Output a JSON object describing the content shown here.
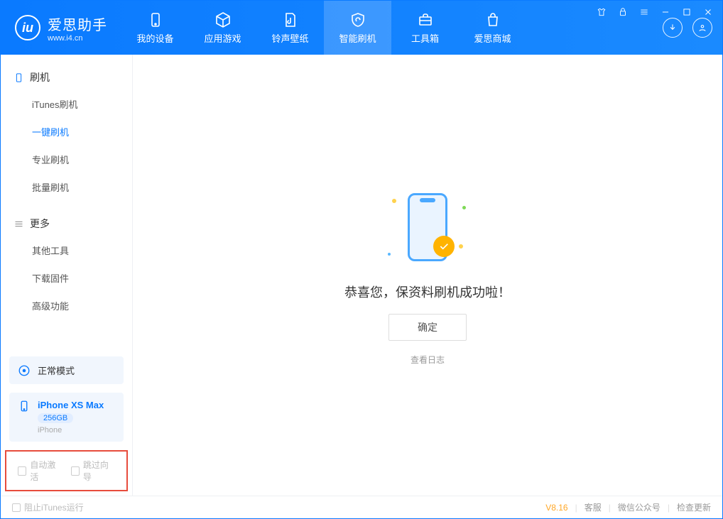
{
  "brand": {
    "name": "爱思助手",
    "url": "www.i4.cn"
  },
  "nav": {
    "tabs": [
      {
        "label": "我的设备"
      },
      {
        "label": "应用游戏"
      },
      {
        "label": "铃声壁纸"
      },
      {
        "label": "智能刷机"
      },
      {
        "label": "工具箱"
      },
      {
        "label": "爱思商城"
      }
    ]
  },
  "sidebar": {
    "section_flash": "刷机",
    "flash_items": [
      {
        "label": "iTunes刷机"
      },
      {
        "label": "一键刷机"
      },
      {
        "label": "专业刷机"
      },
      {
        "label": "批量刷机"
      }
    ],
    "section_more": "更多",
    "more_items": [
      {
        "label": "其他工具"
      },
      {
        "label": "下载固件"
      },
      {
        "label": "高级功能"
      }
    ],
    "mode_label": "正常模式",
    "device": {
      "name": "iPhone XS Max",
      "capacity": "256GB",
      "type": "iPhone"
    },
    "cb_auto_activate": "自动激活",
    "cb_skip_guide": "跳过向导"
  },
  "main": {
    "success_text": "恭喜您，保资料刷机成功啦！",
    "ok_button": "确定",
    "view_log": "查看日志"
  },
  "footer": {
    "block_itunes": "阻止iTunes运行",
    "version": "V8.16",
    "links": {
      "service": "客服",
      "wechat": "微信公众号",
      "update": "检查更新"
    }
  }
}
